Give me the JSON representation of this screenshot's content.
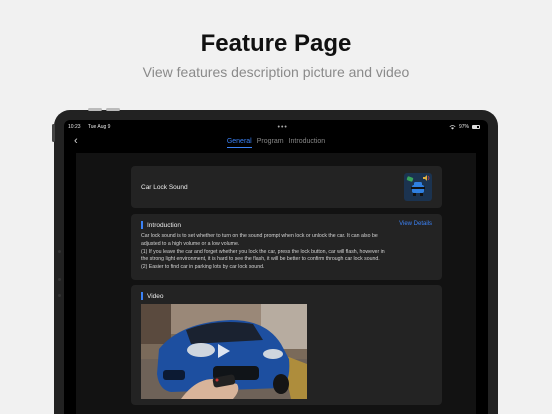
{
  "header": {
    "title": "Feature Page",
    "subtitle": "View features description picture and video"
  },
  "status_bar": {
    "time": "10:23",
    "date": "Tue Aug 9",
    "battery": "97%"
  },
  "nav": {
    "tabs": [
      {
        "label": "General",
        "active": true
      },
      {
        "label": "Program",
        "active": false
      },
      {
        "label": "Introduction",
        "active": false
      }
    ]
  },
  "feature": {
    "title": "Car Lock Sound"
  },
  "introduction": {
    "title": "Introduction",
    "details_link": "View Details",
    "lines": [
      "Car lock sound is to set whether to turn on the sound prompt when lock or unlock the car. It can also be",
      "adjusted to a high volume or a low volume.",
      "(1) If you leave the car and forget whether you lock the car, press the lock button, car will flash, however in",
      "the strong light environment, it is hard to see the flash, it will be better to confirm through car lock sound.",
      "(2) Easier to find car in parking lots by car lock sound."
    ]
  },
  "video": {
    "title": "Video"
  },
  "colors": {
    "accent": "#3b82f6",
    "card_bg": "#232323",
    "car_body": "#1d4fa0"
  }
}
